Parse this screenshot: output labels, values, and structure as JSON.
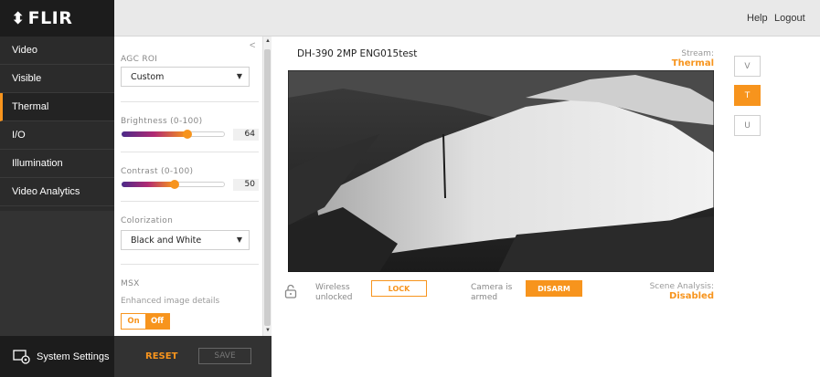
{
  "brand": {
    "name": "FLIR",
    "accent": "#f7941d"
  },
  "header": {
    "help": "Help",
    "logout": "Logout"
  },
  "sidebar": {
    "items": [
      {
        "label": "Video"
      },
      {
        "label": "Visible"
      },
      {
        "label": "Thermal",
        "active": true
      },
      {
        "label": "I/O"
      },
      {
        "label": "Illumination"
      },
      {
        "label": "Video Analytics"
      }
    ],
    "system_settings": "System Settings"
  },
  "panel": {
    "agc_roi_label": "AGC ROI",
    "agc_roi_value": "Custom",
    "brightness_label": "Brightness (0-100)",
    "brightness_value": "64",
    "contrast_label": "Contrast (0-100)",
    "contrast_value": "50",
    "colorization_label": "Colorization",
    "colorization_value": "Black and White",
    "msx_label": "MSX",
    "msx_detail": "Enhanced image details",
    "msx_on": "On",
    "msx_off": "Off",
    "msx_state": "Off",
    "reset": "RESET",
    "save": "SAVE"
  },
  "main": {
    "camera_title": "DH-390 2MP ENG015test",
    "stream_label": "Stream:",
    "stream_value": "Thermal",
    "view_buttons": [
      {
        "label": "V",
        "active": false
      },
      {
        "label": "T",
        "active": true
      },
      {
        "label": "U",
        "active": false
      }
    ],
    "wireless_line1": "Wireless",
    "wireless_line2": "unlocked",
    "lock_button": "LOCK",
    "camera_line1": "Camera is",
    "camera_line2": "armed",
    "disarm_button": "DISARM",
    "scene_label": "Scene Analysis:",
    "scene_value": "Disabled"
  },
  "icons": [
    "flir-logo-icon",
    "collapse-chevron-icon",
    "dropdown-caret-icon",
    "padlock-unlocked-icon",
    "system-settings-icon"
  ]
}
